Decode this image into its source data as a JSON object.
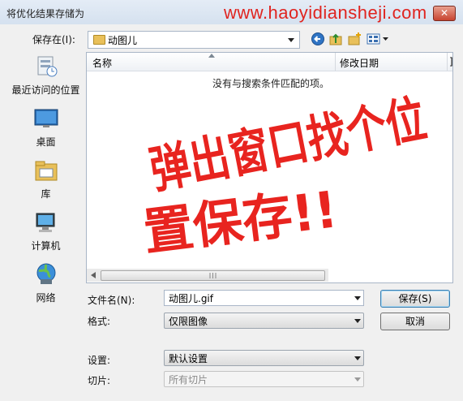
{
  "window": {
    "title": "将优化结果存储为",
    "watermark": "www.haoyidiansheji.com",
    "close_label": "✕"
  },
  "save_in": {
    "label": "保存在(I):",
    "value": "动图儿"
  },
  "places": [
    {
      "label": "最近访问的位置",
      "icon": "recent-places-icon"
    },
    {
      "label": "桌面",
      "icon": "desktop-icon"
    },
    {
      "label": "库",
      "icon": "libraries-icon"
    },
    {
      "label": "计算机",
      "icon": "computer-icon"
    },
    {
      "label": "网络",
      "icon": "network-icon"
    }
  ],
  "file_list": {
    "col_name": "名称",
    "col_date": "修改日期",
    "col_more": "]",
    "empty_message": "没有与搜索条件匹配的项。"
  },
  "filename": {
    "label": "文件名(N):",
    "value": "动图儿.gif"
  },
  "format": {
    "label": "格式:",
    "value": "仅限图像"
  },
  "settings": {
    "label": "设置:",
    "value": "默认设置"
  },
  "slices": {
    "label": "切片:",
    "value": "所有切片"
  },
  "buttons": {
    "save": "保存(S)",
    "cancel": "取消"
  },
  "handwriting": {
    "line1": "弹出窗口找个位",
    "line2": "置保存!!"
  },
  "colors": {
    "handwriting": "#e8241f",
    "watermark": "#e0241f",
    "title_bar": "#dce6f2"
  }
}
